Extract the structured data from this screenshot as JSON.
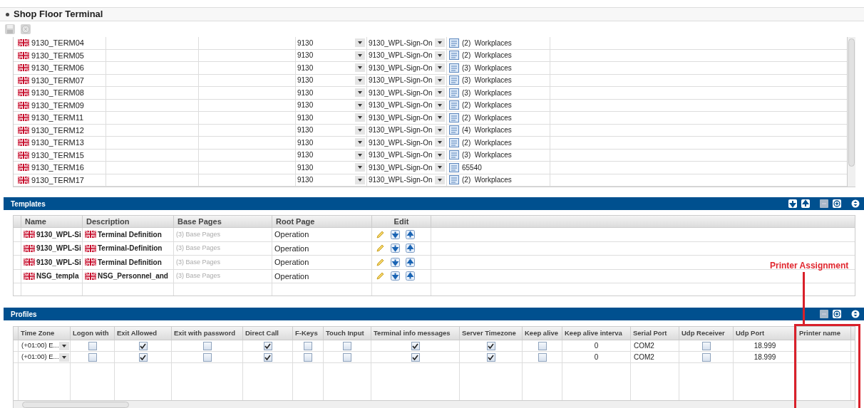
{
  "page_title": "Shop Floor Terminal",
  "terminals": [
    {
      "name": "9130_TERM04",
      "plant": "9130",
      "sign_on": "9130_WPL-Sign-On",
      "workplaces": "(2)  Workplaces"
    },
    {
      "name": "9130_TERM05",
      "plant": "9130",
      "sign_on": "9130_WPL-Sign-On",
      "workplaces": "(2)  Workplaces"
    },
    {
      "name": "9130_TERM06",
      "plant": "9130",
      "sign_on": "9130_WPL-Sign-On",
      "workplaces": "(3)  Workplaces"
    },
    {
      "name": "9130_TERM07",
      "plant": "9130",
      "sign_on": "9130_WPL-Sign-On",
      "workplaces": "(3)  Workplaces"
    },
    {
      "name": "9130_TERM08",
      "plant": "9130",
      "sign_on": "9130_WPL-Sign-On",
      "workplaces": "(3)  Workplaces"
    },
    {
      "name": "9130_TERM09",
      "plant": "9130",
      "sign_on": "9130_WPL-Sign-On",
      "workplaces": "(2)  Workplaces"
    },
    {
      "name": "9130_TERM11",
      "plant": "9130",
      "sign_on": "9130_WPL-Sign-On",
      "workplaces": "(2)  Workplaces"
    },
    {
      "name": "9130_TERM12",
      "plant": "9130",
      "sign_on": "9130_WPL-Sign-On",
      "workplaces": "(4)  Workplaces"
    },
    {
      "name": "9130_TERM13",
      "plant": "9130",
      "sign_on": "9130_WPL-Sign-On",
      "workplaces": "(2)  Workplaces"
    },
    {
      "name": "9130_TERM15",
      "plant": "9130",
      "sign_on": "9130_WPL-Sign-On",
      "workplaces": "(3)  Workplaces"
    },
    {
      "name": "9130_TERM16",
      "plant": "9130",
      "sign_on": "9130_WPL-Sign-On",
      "workplaces": "65540"
    },
    {
      "name": "9130_TERM17",
      "plant": "9130",
      "sign_on": "9130_WPL-Sign-On",
      "workplaces": "(2)  Workplaces"
    }
  ],
  "templates": {
    "title": "Templates",
    "columns": [
      "Name",
      "Description",
      "Base Pages",
      "Root Page",
      "Edit"
    ],
    "rows": [
      {
        "name": "9130_WPL-Si",
        "description": "Terminal Definition",
        "base_pages": "(3) Base Pages",
        "root_page": "Operation"
      },
      {
        "name": "9130_WPL-Si",
        "description": "Terminal-Definition",
        "base_pages": "(3) Base Pages",
        "root_page": "Operation"
      },
      {
        "name": "9130_WPL-Si",
        "description": "Terminal Definition",
        "base_pages": "(3) Base Pages",
        "root_page": "Operation"
      },
      {
        "name": "NSG_templa",
        "description": "NSG_Personnel_and",
        "base_pages": "(3) Base Pages",
        "root_page": "Operation"
      }
    ]
  },
  "profiles": {
    "title": "Profiles",
    "columns": [
      {
        "label": "Time Zone",
        "kind": "select"
      },
      {
        "label": "Logon with",
        "kind": "check"
      },
      {
        "label": "Exit Allowed",
        "kind": "check"
      },
      {
        "label": "Exit with password",
        "kind": "check"
      },
      {
        "label": "Direct Call",
        "kind": "check"
      },
      {
        "label": "F-Keys",
        "kind": "check"
      },
      {
        "label": "Touch Input",
        "kind": "check"
      },
      {
        "label": "Terminal info messages",
        "kind": "check"
      },
      {
        "label": "Server Timezone",
        "kind": "check"
      },
      {
        "label": "Keep alive",
        "kind": "check"
      },
      {
        "label": "Keep alive interva",
        "kind": "number"
      },
      {
        "label": "Serial Port",
        "kind": "text"
      },
      {
        "label": "Udp Receiver",
        "kind": "check"
      },
      {
        "label": "Udp Port",
        "kind": "number"
      },
      {
        "label": "Printer name",
        "kind": "text"
      }
    ],
    "rows": [
      {
        "cells": [
          "(+01:00) E...",
          false,
          true,
          false,
          true,
          false,
          false,
          true,
          true,
          false,
          "0",
          "COM2",
          false,
          "18.999",
          null
        ]
      },
      {
        "cells": [
          "(+01:00) E...",
          false,
          true,
          false,
          true,
          false,
          false,
          true,
          true,
          false,
          "0",
          "COM2",
          false,
          "18.999",
          null
        ]
      }
    ]
  },
  "annotation": {
    "text": "Printer Assignment"
  }
}
